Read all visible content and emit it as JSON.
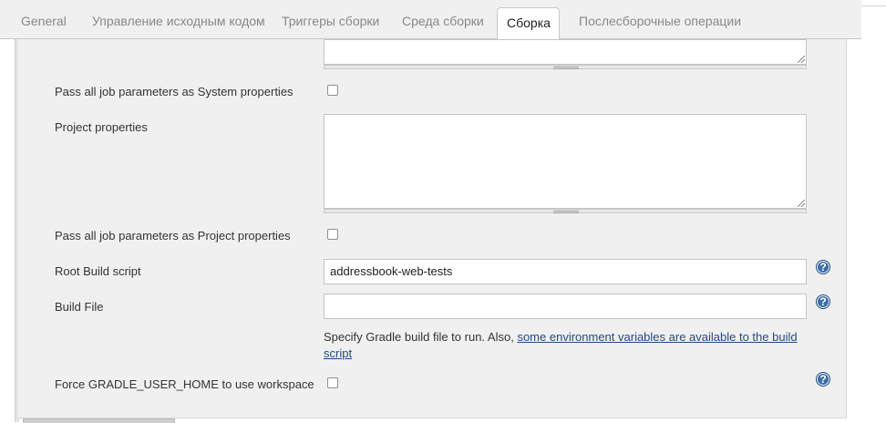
{
  "tabs": [
    {
      "label": "General"
    },
    {
      "label": "Управление исходным кодом"
    },
    {
      "label": "Триггеры сборки"
    },
    {
      "label": "Среда сборки"
    },
    {
      "label": "Сборка"
    },
    {
      "label": "Послесборочные операции"
    }
  ],
  "active_tab": "Сборка",
  "form": {
    "pass_system_props_label": "Pass all job parameters as System properties",
    "project_properties_label": "Project properties",
    "pass_project_props_label": "Pass all job parameters as Project properties",
    "root_build_script_label": "Root Build script",
    "root_build_script_value": "addressbook-web-tests",
    "build_file_label": "Build File",
    "build_file_value": "",
    "build_file_help_prefix": "Specify Gradle build file to run. Also, ",
    "build_file_help_link": "some environment variables are available to the build script",
    "force_gradle_home_label": "Force GRADLE_USER_HOME to use workspace"
  },
  "help_icon_glyph": "?",
  "colors": {
    "panel_bg": "#f0f0f0",
    "link": "#204a87",
    "help_icon": "#3a6ea5"
  }
}
